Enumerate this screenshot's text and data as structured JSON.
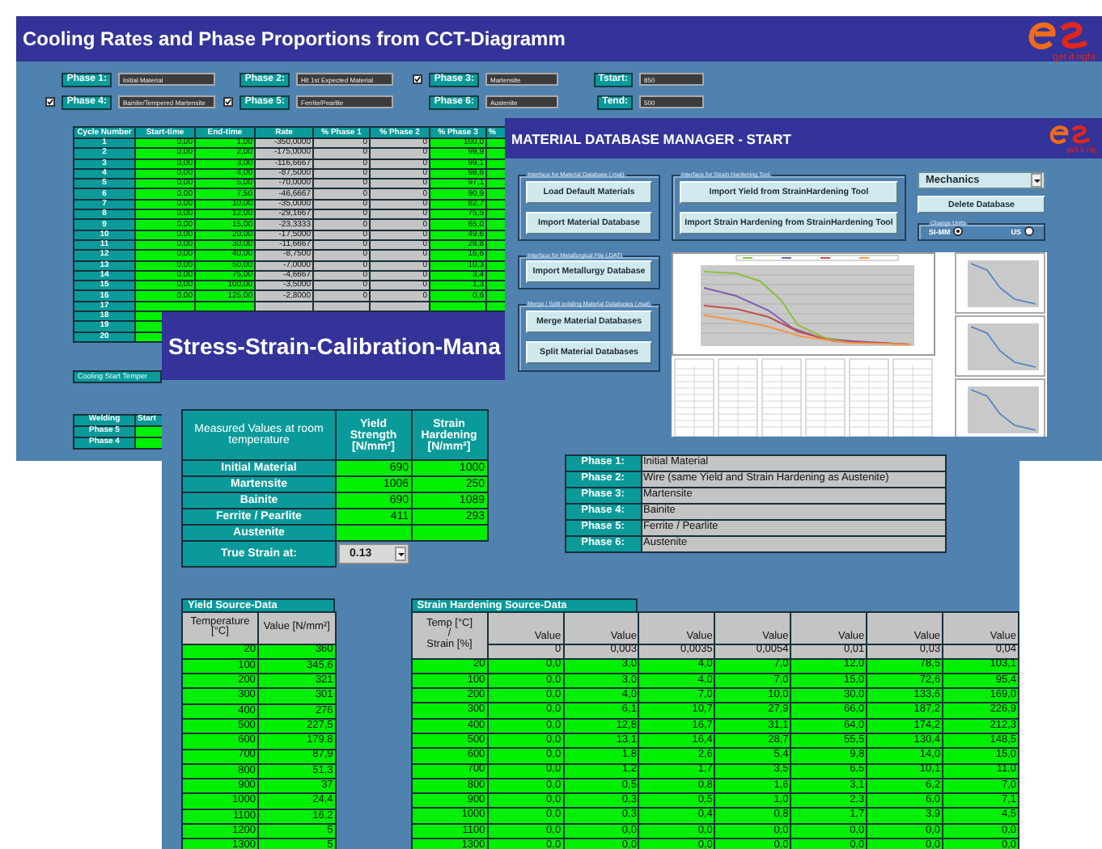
{
  "cooling_window": {
    "title": "Cooling Rates and Phase Proportions from CCT-Diagramm",
    "logo_tagline": "get it right",
    "phases": [
      {
        "label": "Phase 1:",
        "value": "Initial Material",
        "kind": "plain"
      },
      {
        "label": "Phase 2:",
        "value": "Hit 1st Expected Material",
        "kind": "plain"
      },
      {
        "label": "Phase 3:",
        "value": "Martensite",
        "kind": "check",
        "checked": true
      },
      {
        "label": "Phase 4:",
        "value": "Bainite/Tempered Martensite",
        "kind": "check",
        "checked": true
      },
      {
        "label": "Phase 5:",
        "value": "Ferrite/Pearlite",
        "kind": "check",
        "checked": true
      },
      {
        "label": "Phase 6:",
        "value": "Austenite",
        "kind": "plain"
      }
    ],
    "temperatures": [
      {
        "label": "Tstart:",
        "value": "850"
      },
      {
        "label": "Tend:",
        "value": "500"
      }
    ],
    "table": {
      "columns": [
        {
          "label": "Cycle Number",
          "kind": "index"
        },
        {
          "label": "Start-time",
          "kind": "input"
        },
        {
          "label": "End-time",
          "kind": "input"
        },
        {
          "label": "Rate",
          "kind": "computed"
        },
        {
          "label": "% Phase 1",
          "kind": "computed"
        },
        {
          "label": "% Phase 2",
          "kind": "computed"
        },
        {
          "label": "% Phase 3",
          "kind": "input"
        },
        {
          "label": "%",
          "kind": "input"
        }
      ],
      "rows": [
        [
          "1",
          "0,00",
          "1,00",
          "-350,0000",
          "0",
          "0",
          "100,0"
        ],
        [
          "2",
          "0,00",
          "2,00",
          "-175,0000",
          "0",
          "0",
          "99,9"
        ],
        [
          "3",
          "0,00",
          "3,00",
          "-116,6667",
          "0",
          "0",
          "99,1"
        ],
        [
          "4",
          "0,00",
          "4,00",
          "-87,5000",
          "0",
          "0",
          "98,6"
        ],
        [
          "5",
          "0,00",
          "5,00",
          "-70,0000",
          "0",
          "0",
          "97,1"
        ],
        [
          "6",
          "0,00",
          "7,50",
          "-46,6667",
          "0",
          "0",
          "90,9"
        ],
        [
          "7",
          "0,00",
          "10,00",
          "-35,0000",
          "0",
          "0",
          "82,7"
        ],
        [
          "8",
          "0,00",
          "12,00",
          "-29,1667",
          "0",
          "0",
          "75,5"
        ],
        [
          "9",
          "0,00",
          "15,00",
          "-23,3333",
          "0",
          "0",
          "65,0"
        ],
        [
          "10",
          "0,00",
          "20,00",
          "-17,5000",
          "0",
          "0",
          "49,6"
        ],
        [
          "11",
          "0,00",
          "30,00",
          "-11,6667",
          "0",
          "0",
          "28,8"
        ],
        [
          "12",
          "0,00",
          "40,00",
          "-8,7500",
          "0",
          "0",
          "16,6"
        ],
        [
          "13",
          "0,00",
          "50,00",
          "-7,0000",
          "0",
          "0",
          "10,3"
        ],
        [
          "14",
          "0,00",
          "75,00",
          "-4,6667",
          "0",
          "0",
          "3,4"
        ],
        [
          "15",
          "0,00",
          "100,00",
          "-3,5000",
          "0",
          "0",
          "1,3"
        ],
        [
          "16",
          "0,00",
          "125,00",
          "-2,8000",
          "0",
          "0",
          "0,6"
        ],
        [
          "17"
        ],
        [
          "18"
        ],
        [
          "19"
        ],
        [
          "20"
        ]
      ]
    },
    "cooling_start_label": "Cooling Start Temper",
    "welding_table": {
      "columns": [
        "Welding",
        "Start"
      ],
      "rows": [
        "Phase 5",
        "Phase 4"
      ]
    }
  },
  "calibration_window": {
    "title": "Stress-Strain-Calibration-Mana",
    "measured_table": {
      "columns": [
        "Measured Values at room temperature",
        "Yield Strength [N/mm²]",
        "Strain Hardening [N/mm²]"
      ],
      "rows": [
        {
          "label": "Initial Material",
          "values": [
            "690",
            "1000"
          ]
        },
        {
          "label": "Martensite",
          "values": [
            "1006",
            "250"
          ]
        },
        {
          "label": "Bainite",
          "values": [
            "690",
            "1089"
          ]
        },
        {
          "label": "Ferrite / Pearlite",
          "values": [
            "411",
            "293"
          ]
        },
        {
          "label": "Austenite",
          "values": []
        }
      ],
      "true_strain": {
        "label": "True Strain at:",
        "value": "0.13"
      }
    },
    "phase_table": [
      {
        "label": "Phase 1:",
        "value": "Initial Material"
      },
      {
        "label": "Phase 2:",
        "value": "Wire (same Yield and Strain Hardening as Austenite)"
      },
      {
        "label": "Phase 3:",
        "value": "Martensite"
      },
      {
        "label": "Phase 4:",
        "value": "Bainite"
      },
      {
        "label": "Phase 5:",
        "value": "Ferrite / Pearlite"
      },
      {
        "label": "Phase 6:",
        "value": "Austenite"
      }
    ],
    "yield_table": {
      "title": "Yield Source-Data",
      "columns": [
        "Temperature [°C]",
        "Value [N/mm²]"
      ],
      "rows": [
        [
          "20",
          "360"
        ],
        [
          "100",
          "345,6"
        ],
        [
          "200",
          "321"
        ],
        [
          "300",
          "301"
        ],
        [
          "400",
          "276"
        ],
        [
          "500",
          "227,5"
        ],
        [
          "600",
          "179,8"
        ],
        [
          "700",
          "87,9"
        ],
        [
          "800",
          "51,3"
        ],
        [
          "900",
          "37"
        ],
        [
          "1000",
          "24,4"
        ],
        [
          "1100",
          "16,2"
        ],
        [
          "1200",
          "5"
        ],
        [
          "1300",
          "5"
        ]
      ]
    },
    "hardening_table": {
      "title": "Strain Hardening Source-Data",
      "columns": [
        {
          "label": "Temp [°C]\n/\nStrain [%]"
        },
        {
          "label": "Value",
          "strain": "0"
        },
        {
          "label": "Value",
          "strain": "0,003"
        },
        {
          "label": "Value",
          "strain": "0,0035"
        },
        {
          "label": "Value",
          "strain": "0,0054"
        },
        {
          "label": "Value",
          "strain": "0,01"
        },
        {
          "label": "Value",
          "strain": "0,03"
        },
        {
          "label": "Value",
          "strain": "0,04"
        }
      ],
      "rows": [
        [
          "20",
          "0,0",
          "3,0",
          "4,0",
          "7,0",
          "12,0",
          "78,5",
          "103,1"
        ],
        [
          "100",
          "0,0",
          "3,0",
          "4,0",
          "7,0",
          "15,0",
          "72,6",
          "95,4"
        ],
        [
          "200",
          "0,0",
          "4,0",
          "7,0",
          "10,0",
          "30,0",
          "133,6",
          "169,0"
        ],
        [
          "300",
          "0,0",
          "6,1",
          "10,7",
          "27,9",
          "66,0",
          "187,2",
          "226,9"
        ],
        [
          "400",
          "0,0",
          "12,8",
          "16,7",
          "31,1",
          "64,0",
          "174,2",
          "212,3"
        ],
        [
          "500",
          "0,0",
          "13,1",
          "16,4",
          "28,7",
          "55,5",
          "130,4",
          "148,5"
        ],
        [
          "600",
          "0,0",
          "1,8",
          "2,6",
          "5,4",
          "9,8",
          "14,0",
          "15,0"
        ],
        [
          "700",
          "0,0",
          "1,2",
          "1,7",
          "3,5",
          "6,5",
          "10,1",
          "11,0"
        ],
        [
          "800",
          "0,0",
          "0,5",
          "0,8",
          "1,6",
          "3,1",
          "6,2",
          "7,0"
        ],
        [
          "900",
          "0,0",
          "0,3",
          "0,5",
          "1,0",
          "2,3",
          "6,0",
          "7,1"
        ],
        [
          "1000",
          "0,0",
          "0,3",
          "0,4",
          "0,8",
          "1,7",
          "3,9",
          "4,5"
        ],
        [
          "1100",
          "0,0",
          "0,0",
          "0,0",
          "0,0",
          "0,0",
          "0,0",
          "0,0"
        ],
        [
          "1300",
          "0,0",
          "0,0",
          "0,0",
          "0,0",
          "0,0",
          "0,0",
          "0,0"
        ]
      ]
    }
  },
  "database_window": {
    "title": "MATERIAL DATABASE MANAGER - START",
    "logo_tagline": "get it rig",
    "groups": [
      {
        "label": "Interface for Material Database (.mat)",
        "buttons": [
          "Load Default Materials",
          "Import Material Database"
        ]
      },
      {
        "label": "Interface for Strain Hardening Tool",
        "buttons": [
          "Import Yield from StrainHardening Tool",
          "Import Strain Hardening from StrainHardening Tool"
        ]
      },
      {
        "label": "Interface for Metallurgical File (.DAT)",
        "buttons": [
          "Import Metallurgy Database"
        ]
      },
      {
        "label": "Merge / Split existing Material Databases (.mat)",
        "buttons": [
          "Merge Material Databases",
          "Split Material Databases"
        ]
      }
    ],
    "database_type": "Mechanics",
    "delete_button": "Delete Database",
    "units": {
      "label": "Change Units",
      "options": [
        {
          "label": "SI-MM",
          "selected": true
        },
        {
          "label": "US",
          "selected": false
        }
      ]
    }
  }
}
